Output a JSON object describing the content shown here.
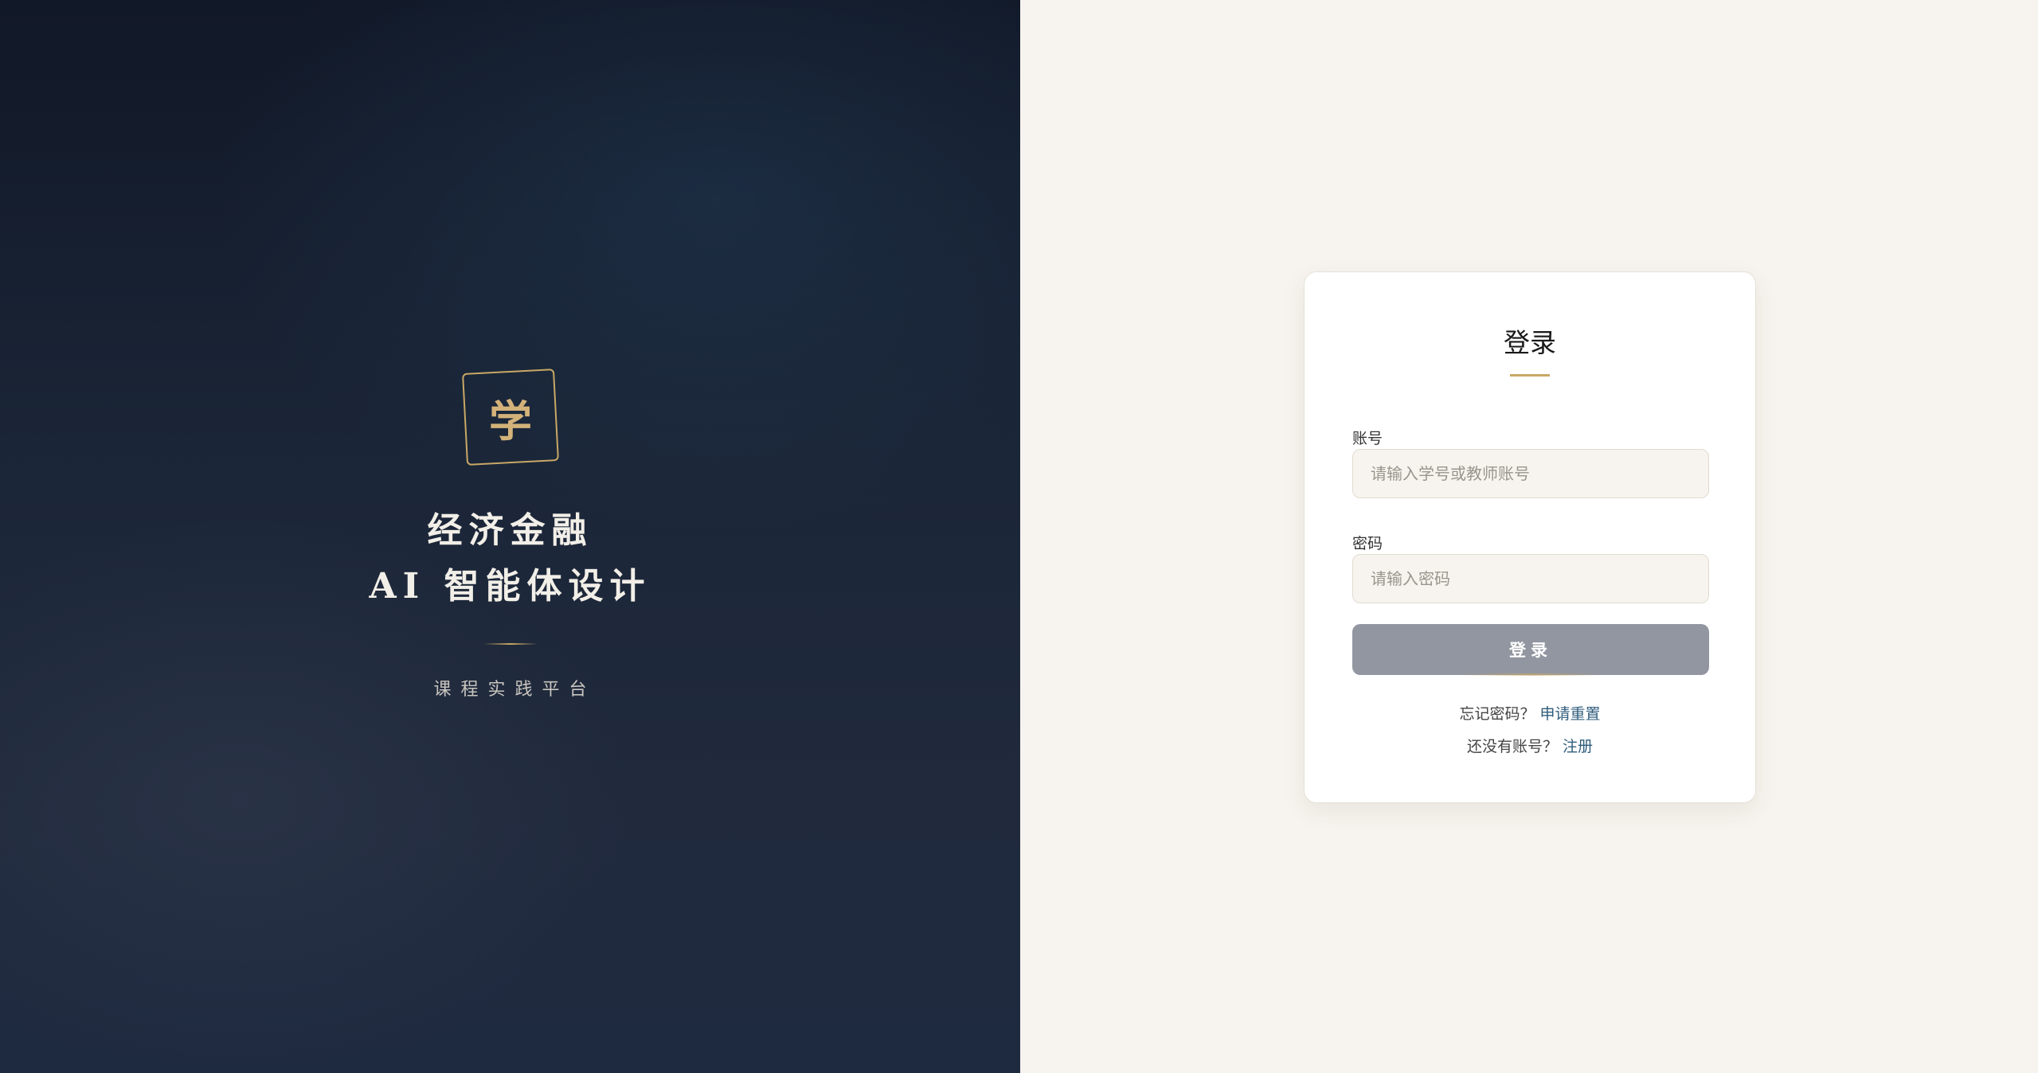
{
  "brand": {
    "logo_char": "学",
    "title_line1": "经济金融",
    "title_line2": "AI 智能体设计",
    "subtitle": "课程实践平台"
  },
  "login": {
    "title": "登录",
    "account_label": "账号",
    "account_placeholder": "请输入学号或教师账号",
    "password_label": "密码",
    "password_placeholder": "请输入密码",
    "submit_label": "登录",
    "forgot_text": "忘记密码？",
    "reset_link": "申请重置",
    "no_account_text": "还没有账号？",
    "register_link": "注册"
  },
  "colors": {
    "left_bg": "#1b2638",
    "accent_gold": "#c9a865",
    "right_bg": "#f7f4ef",
    "button_bg": "#9296a0",
    "link": "#2f5d7c"
  }
}
